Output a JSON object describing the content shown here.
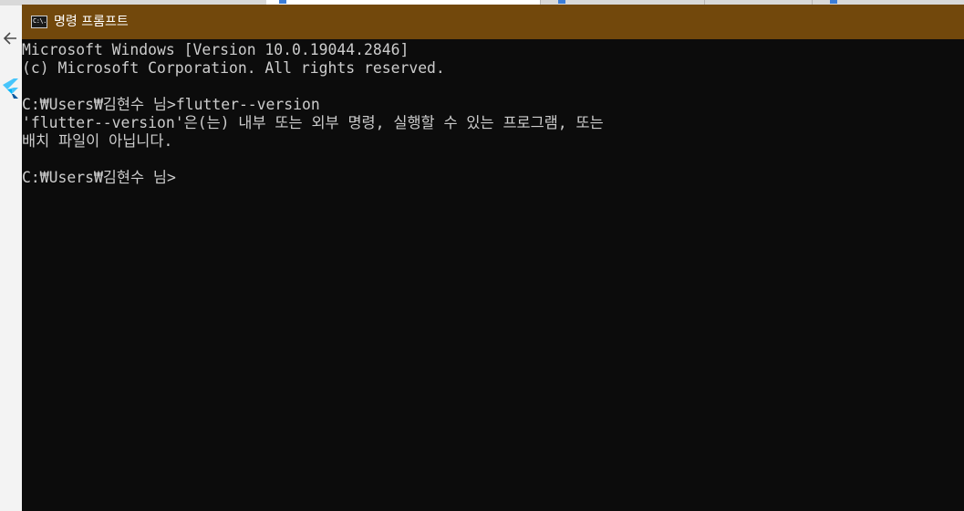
{
  "window": {
    "title": "명령 프롬프트",
    "icon_label": "C:\\."
  },
  "console": {
    "lines": [
      "Microsoft Windows [Version 10.0.19044.2846]",
      "(c) Microsoft Corporation. All rights reserved.",
      "",
      "C:₩Users₩김현수 님>flutter--version",
      "'flutter--version'은(는) 내부 또는 외부 명령, 실행할 수 있는 프로그램, 또는",
      "배치 파일이 아닙니다.",
      "",
      "C:₩Users₩김현수 님>"
    ]
  },
  "icons": {
    "console_app": "command-prompt-icon",
    "background_back": "back-arrow-icon",
    "background_app": "flutter-logo-icon"
  },
  "colors": {
    "titlebar": "#72480c",
    "console_background": "#0c0c0c",
    "console_text": "#cccccc",
    "title_text": "#ffffff"
  }
}
